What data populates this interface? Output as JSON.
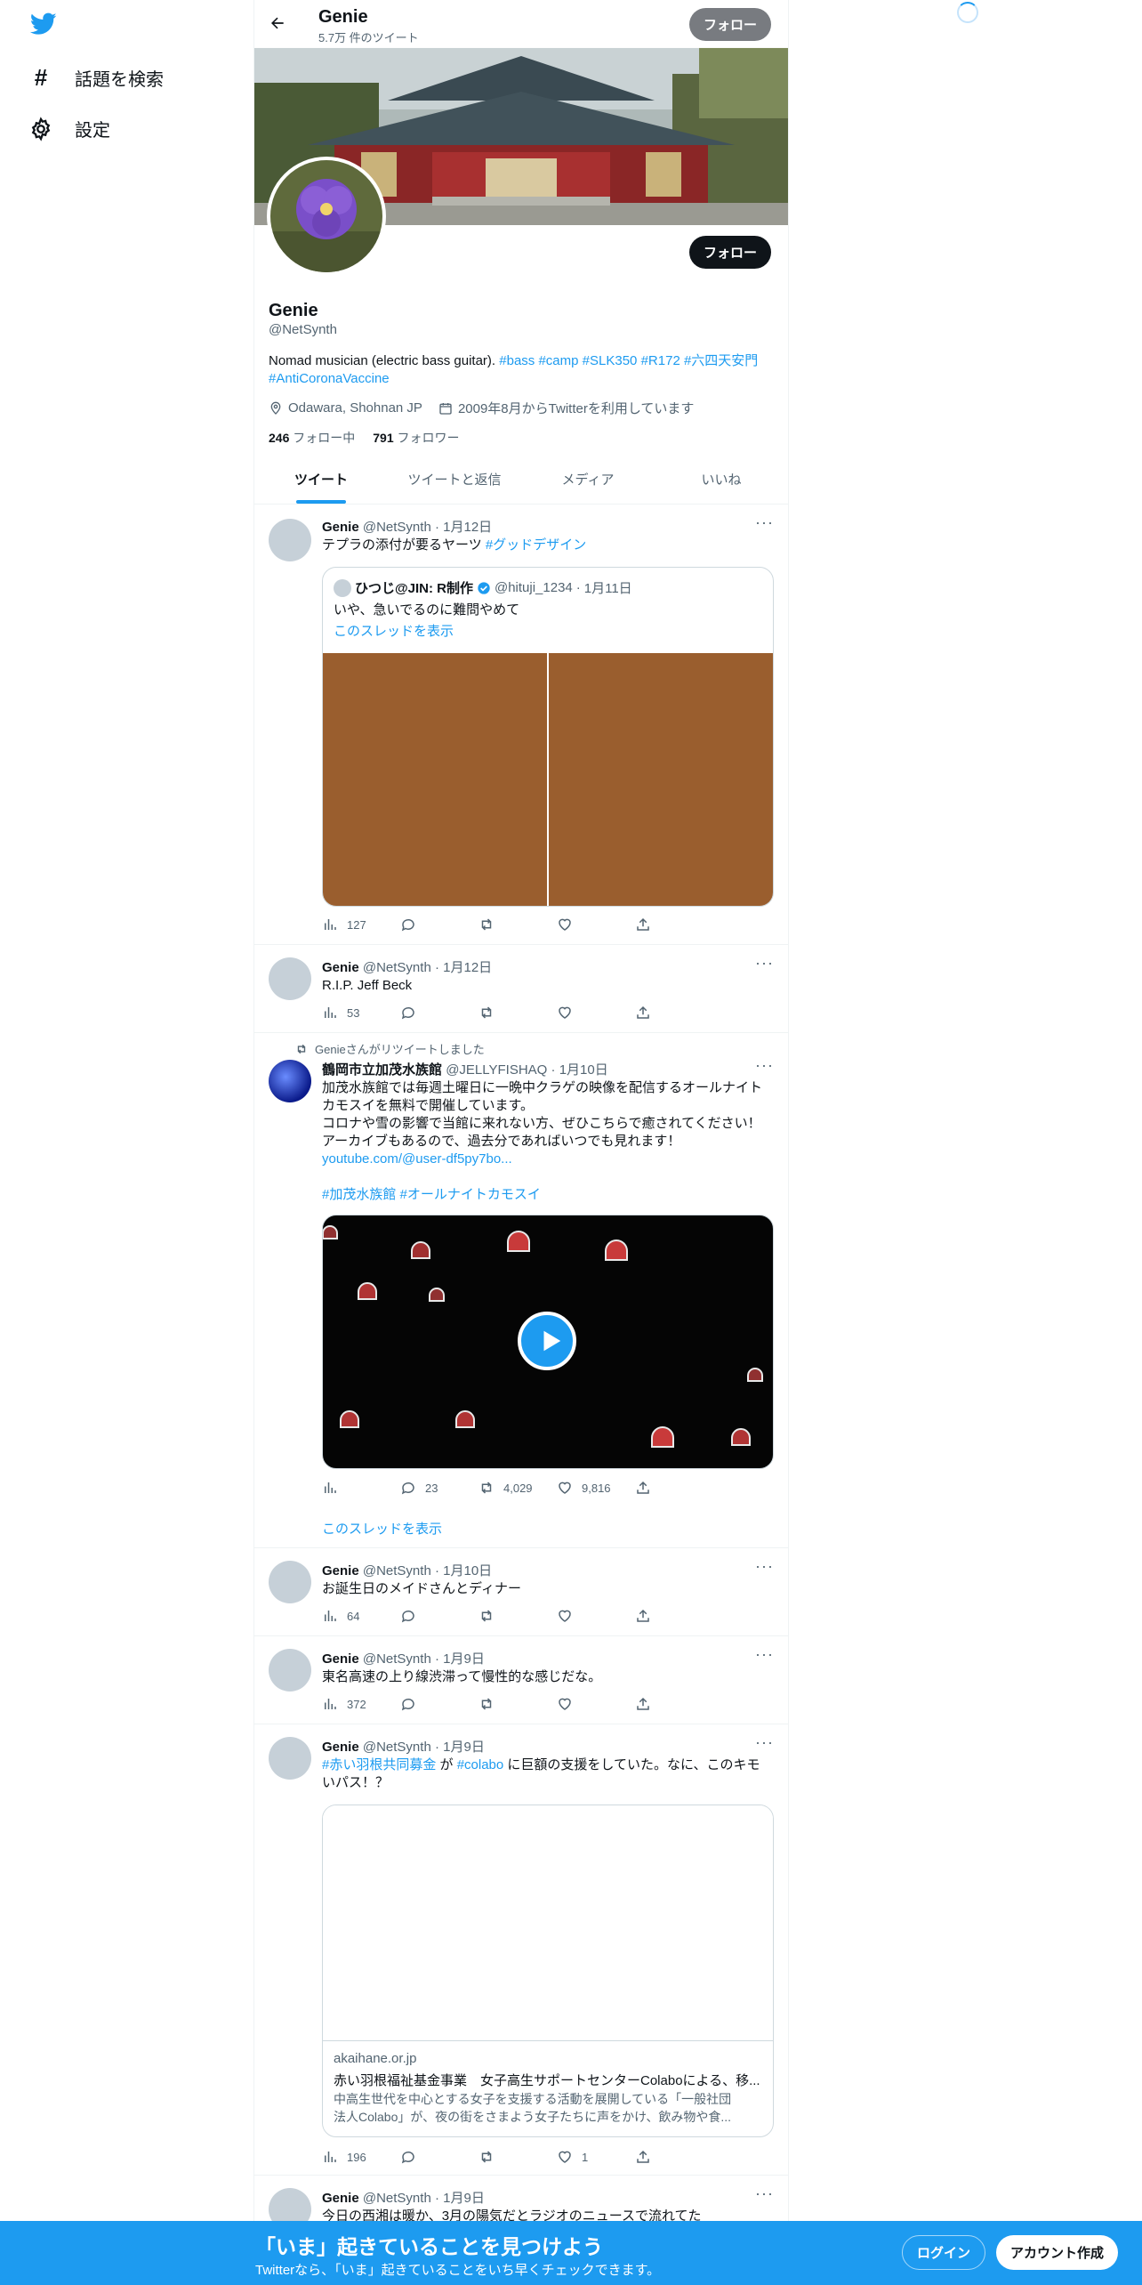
{
  "nav": {
    "explore_label": "話題を検索",
    "settings_label": "設定"
  },
  "header": {
    "name": "Genie",
    "tweet_count": "5.7万 件のツイート",
    "follow_label": "フォロー"
  },
  "profile": {
    "follow_label": "フォロー",
    "name": "Genie",
    "handle": "@NetSynth",
    "bio_text": "Nomad musician (electric bass guitar). ",
    "bio_tags": [
      "#bass",
      "#camp",
      "#SLK350",
      "#R172",
      "#六四天安門"
    ],
    "bio_tag2": "#AntiCoronaVaccine",
    "location": "Odawara, Shohnan JP",
    "joined": "2009年8月からTwitterを利用しています",
    "following_count": "246",
    "following_label": "フォロー中",
    "followers_count": "791",
    "followers_label": "フォロワー"
  },
  "tabs": [
    "ツイート",
    "ツイートと返信",
    "メディア",
    "いいね"
  ],
  "tweets": [
    {
      "name": "Genie",
      "handle": "@NetSynth",
      "date": "1月12日",
      "text": "テプラの添付が要るヤーツ ",
      "tag": "#グッドデザイン",
      "quote": {
        "name": "ひつじ@JIN: R制作",
        "handle": "@hituji_1234",
        "date": "1月11日",
        "text": "いや、急いでるのに難問やめて",
        "thread_link": "このスレッドを表示"
      },
      "views": "127"
    },
    {
      "name": "Genie",
      "handle": "@NetSynth",
      "date": "1月12日",
      "text": "R.I.P. Jeff Beck",
      "views": "53"
    },
    {
      "retweet_label": "Genieさんがリツイートしました",
      "name": "鶴岡市立加茂水族館",
      "handle": "@JELLYFISHAQ",
      "date": "1月10日",
      "lines": [
        "加茂水族館では毎週土曜日に一晩中クラゲの映像を配信するオールナイト",
        "カモスイを無料で開催しています。",
        "コロナや雪の影響で当館に来れない方、ぜひこちらで癒されてください！",
        "アーカイブもあるので、過去分であればいつでも見れます！"
      ],
      "link": "youtube.com/@user-df5py7bo...",
      "tags": "#加茂水族館 #オールナイトカモスイ",
      "replies": "23",
      "retweets": "4,029",
      "likes": "9,816",
      "thread_link": "このスレッドを表示"
    },
    {
      "name": "Genie",
      "handle": "@NetSynth",
      "date": "1月10日",
      "text": "お誕生日のメイドさんとディナー",
      "views": "64"
    },
    {
      "name": "Genie",
      "handle": "@NetSynth",
      "date": "1月9日",
      "text": "東名高速の上り線渋滞って慢性的な感じだな。",
      "views": "372"
    },
    {
      "name": "Genie",
      "handle": "@NetSynth",
      "date": "1月9日",
      "tag1": "#赤い羽根共同募金",
      "mid1": " が ",
      "tag2": "#colabo",
      "text_rest": " に巨額の支援をしていた。なに、このキモ",
      "text_line2": "いパス！？",
      "card": {
        "domain": "akaihane.or.jp",
        "title": "赤い羽根福祉基金事業　女子高生サポートセンターColaboによる、移...",
        "desc1": "中高生世代を中心とする女子を支援する活動を展開している「一般社団",
        "desc2": "法人Colabo」が、夜の街をさまよう女子たちに声をかけ、飲み物や食..."
      },
      "views": "196",
      "likes": "1"
    },
    {
      "name": "Genie",
      "handle": "@NetSynth",
      "date": "1月9日",
      "text": "今日の西湘は暖か、3月の陽気だとラジオのニュースで流れてた"
    }
  ],
  "bottom_bar": {
    "title": "「いま」起きていることを見つけよう",
    "subtitle": "Twitterなら、「いま」起きていることをいち早くチェックできます。",
    "login_label": "ログイン",
    "signup_label": "アカウント作成"
  },
  "colors": {
    "accent": "#1d9bf0",
    "bottom_bar": "#1d9bf0",
    "text": "#0f1419",
    "muted": "#536471"
  },
  "icons": [
    "twitter-logo-icon",
    "hashtag-icon",
    "gear-icon",
    "back-arrow-icon",
    "location-icon",
    "calendar-icon",
    "verified-icon",
    "retweet-icon",
    "reply-icon",
    "like-icon",
    "share-icon",
    "views-icon",
    "more-icon",
    "play-icon",
    "loading-spinner-icon"
  ]
}
